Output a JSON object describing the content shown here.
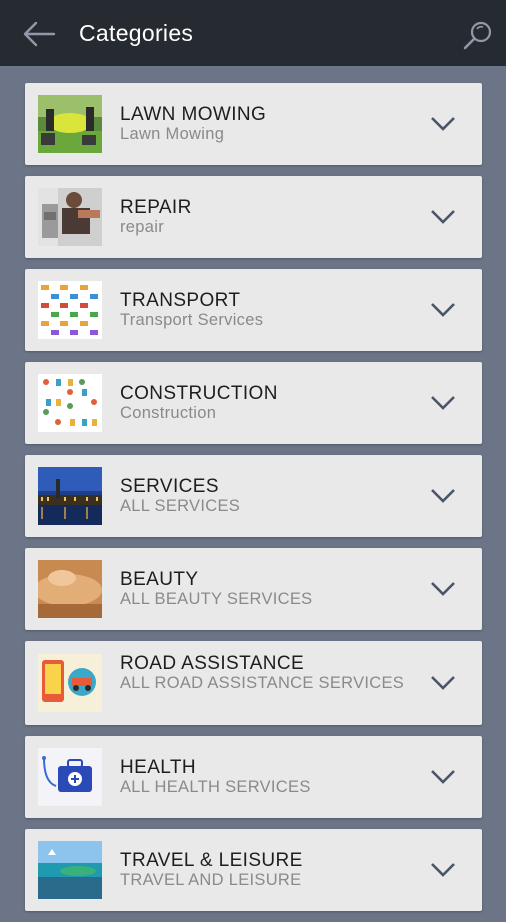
{
  "header": {
    "title": "Categories",
    "back_icon": "arrow-left-icon",
    "search_icon": "search-icon"
  },
  "categories": [
    {
      "name": "LAWN MOWING",
      "sub": "Lawn Mowing",
      "image": "lawn-mowing-photo"
    },
    {
      "name": "REPAIR",
      "sub": "repair",
      "image": "repair-photo"
    },
    {
      "name": "TRANSPORT",
      "sub": "Transport Services",
      "image": "transport-icons-image"
    },
    {
      "name": "CONSTRUCTION",
      "sub": "Construction",
      "image": "construction-tools-image"
    },
    {
      "name": "SERVICES",
      "sub": "ALL SERVICES",
      "image": "city-night-photo"
    },
    {
      "name": "BEAUTY",
      "sub": "ALL BEAUTY SERVICES",
      "image": "massage-photo"
    },
    {
      "name": "ROAD ASSISTANCE",
      "sub": "ALL ROAD ASSISTANCE SERVICES",
      "image": "road-assistance-illustration"
    },
    {
      "name": "HEALTH",
      "sub": "ALL HEALTH SERVICES",
      "image": "medical-kit-illustration"
    },
    {
      "name": "TRAVEL & LEISURE",
      "sub": "TRAVEL AND LEISURE",
      "image": "beach-resort-photo"
    }
  ],
  "colors": {
    "appbar": "#262b31",
    "background": "#6b7587",
    "card": "#e9e9e9",
    "chevron": "#4a5568"
  }
}
